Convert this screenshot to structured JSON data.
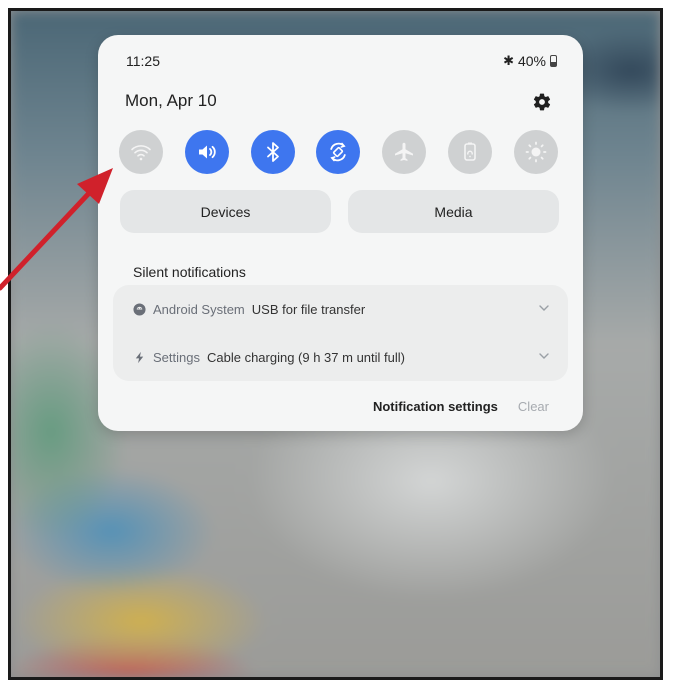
{
  "status_bar": {
    "time": "11:25",
    "bluetooth_glyph": "✱",
    "battery_percent": "40%"
  },
  "header": {
    "date": "Mon, Apr 10",
    "settings_icon": "gear-icon"
  },
  "quick_toggles": [
    {
      "name": "Wi-Fi",
      "icon": "wifi-icon",
      "state": "off"
    },
    {
      "name": "Sound",
      "icon": "sound-icon",
      "state": "on"
    },
    {
      "name": "Bluetooth",
      "icon": "bluetooth-icon",
      "state": "on"
    },
    {
      "name": "Auto rotate",
      "icon": "auto-rotate-icon",
      "state": "on"
    },
    {
      "name": "Airplane mode",
      "icon": "airplane-icon",
      "state": "off"
    },
    {
      "name": "Power saving",
      "icon": "power-saving-icon",
      "state": "off"
    },
    {
      "name": "Brightness",
      "icon": "brightness-icon",
      "state": "off"
    }
  ],
  "buttons": {
    "devices": "Devices",
    "media": "Media"
  },
  "notifications": {
    "section_title": "Silent notifications",
    "items": [
      {
        "app": "Android System",
        "text": "USB for file transfer",
        "icon": "android-system-icon"
      },
      {
        "app": "Settings",
        "text": "Cable charging (9 h 37 m until full)",
        "icon": "lightning-icon"
      }
    ],
    "settings_label": "Notification settings",
    "clear_label": "Clear"
  },
  "colors": {
    "accent": "#3e76ef",
    "toggle_off": "#cfd1d2",
    "panel": "#f5f6f6",
    "annotation_arrow": "#d0212b"
  }
}
